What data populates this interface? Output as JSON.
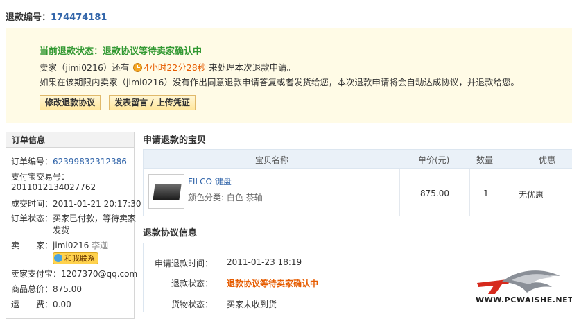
{
  "refund": {
    "label": "退款编号：",
    "number": "174474181"
  },
  "notice": {
    "status_label": "当前退款状态：",
    "status_value": "退款协议等待卖家确认中",
    "seller_prefix": "卖家（jimi0216）还有",
    "countdown": "4小时22分28秒",
    "seller_suffix": "来处理本次退款申请。",
    "info": "如果在该期限内卖家（jimi0216）没有作出同意退款申请答复或者发货给您，本次退款申请将会自动达成协议，并退款给您。",
    "btn_modify": "修改退款协议",
    "btn_message": "发表留言 / 上传凭证"
  },
  "order": {
    "title": "订单信息",
    "order_no_label": "订单编号：",
    "order_no": "62399832312386",
    "alipay_no_label": "支付宝交易号：",
    "alipay_no": "2011012134027762",
    "deal_time_label": "成交时间：",
    "deal_time": "2011-01-21 20:17:30",
    "state_label": "订单状态：",
    "state_line1": "买家已付款，等待卖家",
    "state_line2": "发货",
    "seller_label": "卖　　家：",
    "seller_id": "jimi0216",
    "seller_name": "李迦",
    "contact_btn": "和我联系",
    "seller_alipay_label": "卖家支付宝：",
    "seller_alipay": "1207370@qq.com",
    "total_label": "商品总价：",
    "total": "875.00",
    "freight_label": "运　　费：",
    "freight": "0.00"
  },
  "items_section": {
    "title": "申请退款的宝贝",
    "headers": {
      "name": "宝贝名称",
      "price": "单价(元)",
      "qty": "数量",
      "discount": "优惠"
    },
    "item": {
      "name": "FILCO 键盘",
      "color": "颜色分类: 白色 茶轴",
      "price": "875.00",
      "qty": "1",
      "discount": "无优惠"
    }
  },
  "agreement": {
    "title": "退款协议信息",
    "apply_time_label": "申请退款时间：",
    "apply_time": "2011-01-23 18:19",
    "status_label": "退款状态：",
    "status": "退款协议等待卖家确认中",
    "goods_label": "货物状态：",
    "goods": "买家未收到货"
  },
  "watermark": {
    "text": "WWW.PCWAISHE.NET"
  }
}
